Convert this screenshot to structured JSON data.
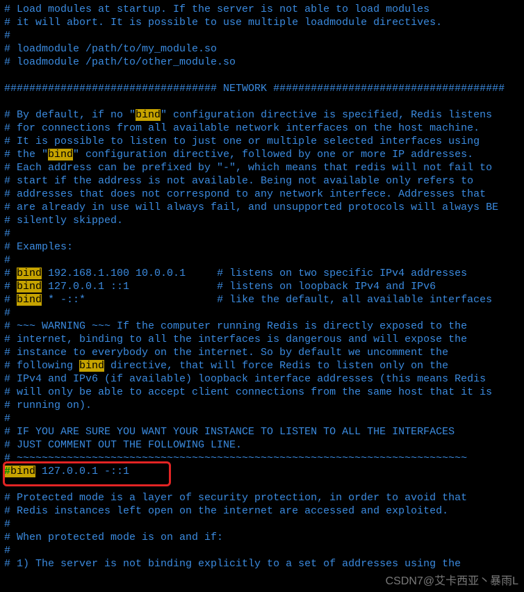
{
  "lines": [
    {
      "segments": [
        {
          "t": "# Load modules at startup. If the server is not able to load modules"
        }
      ]
    },
    {
      "segments": [
        {
          "t": "# it will abort. It is possible to use multiple loadmodule directives."
        }
      ]
    },
    {
      "segments": [
        {
          "t": "#"
        }
      ]
    },
    {
      "segments": [
        {
          "t": "# loadmodule /path/to/my_module.so"
        }
      ]
    },
    {
      "segments": [
        {
          "t": "# loadmodule /path/to/other_module.so"
        }
      ]
    },
    {
      "segments": [
        {
          "t": ""
        }
      ]
    },
    {
      "segments": [
        {
          "t": "################################## NETWORK #####################################"
        }
      ]
    },
    {
      "segments": [
        {
          "t": ""
        }
      ]
    },
    {
      "segments": [
        {
          "t": "# By default, if no \""
        },
        {
          "t": "bind",
          "cls": "hl"
        },
        {
          "t": "\" configuration directive is specified, Redis listens"
        }
      ]
    },
    {
      "segments": [
        {
          "t": "# for connections from all available network interfaces on the host machine."
        }
      ]
    },
    {
      "segments": [
        {
          "t": "# It is possible to listen to just one or multiple selected interfaces using"
        }
      ]
    },
    {
      "segments": [
        {
          "t": "# the \""
        },
        {
          "t": "bind",
          "cls": "hl"
        },
        {
          "t": "\" configuration directive, followed by one or more IP addresses."
        }
      ]
    },
    {
      "segments": [
        {
          "t": "# Each address can be prefixed by \"-\", which means that redis will not fail to"
        }
      ]
    },
    {
      "segments": [
        {
          "t": "# start if the address is not available. Being not available only refers to"
        }
      ]
    },
    {
      "segments": [
        {
          "t": "# addresses that does not correspond to any network interfece. Addresses that"
        }
      ]
    },
    {
      "segments": [
        {
          "t": "# are already in use will always fail, and unsupported protocols will always BE"
        }
      ]
    },
    {
      "segments": [
        {
          "t": "# silently skipped."
        }
      ]
    },
    {
      "segments": [
        {
          "t": "#"
        }
      ]
    },
    {
      "segments": [
        {
          "t": "# Examples:"
        }
      ]
    },
    {
      "segments": [
        {
          "t": "#"
        }
      ]
    },
    {
      "segments": [
        {
          "t": "# "
        },
        {
          "t": "bind",
          "cls": "hl"
        },
        {
          "t": " 192.168.1.100 10.0.0.1     # listens on two specific IPv4 addresses"
        }
      ]
    },
    {
      "segments": [
        {
          "t": "# "
        },
        {
          "t": "bind",
          "cls": "hl"
        },
        {
          "t": " 127.0.0.1 ::1              # listens on loopback IPv4 and IPv6"
        }
      ]
    },
    {
      "segments": [
        {
          "t": "# "
        },
        {
          "t": "bind",
          "cls": "hl"
        },
        {
          "t": " * -::*                     # like the default, all available interfaces"
        }
      ]
    },
    {
      "segments": [
        {
          "t": "#"
        }
      ]
    },
    {
      "segments": [
        {
          "t": "# ~~~ WARNING ~~~ If the computer running Redis is directly exposed to the"
        }
      ]
    },
    {
      "segments": [
        {
          "t": "# internet, binding to all the interfaces is dangerous and will expose the"
        }
      ]
    },
    {
      "segments": [
        {
          "t": "# instance to everybody on the internet. So by default we uncomment the"
        }
      ]
    },
    {
      "segments": [
        {
          "t": "# following "
        },
        {
          "t": "bind",
          "cls": "hl"
        },
        {
          "t": " directive, that will force Redis to listen only on the"
        }
      ]
    },
    {
      "segments": [
        {
          "t": "# IPv4 and IPv6 (if available) loopback interface addresses (this means Redis"
        }
      ]
    },
    {
      "segments": [
        {
          "t": "# will only be able to accept client connections from the same host that it is"
        }
      ]
    },
    {
      "segments": [
        {
          "t": "# running on)."
        }
      ]
    },
    {
      "segments": [
        {
          "t": "#"
        }
      ]
    },
    {
      "segments": [
        {
          "t": "# IF YOU ARE SURE YOU WANT YOUR INSTANCE TO LISTEN TO ALL THE INTERFACES"
        }
      ]
    },
    {
      "segments": [
        {
          "t": "# JUST COMMENT OUT THE FOLLOWING LINE."
        }
      ]
    },
    {
      "segments": [
        {
          "t": "# ~~~~~~~~~~~~~~~~~~~~~~~~~~~~~~~~~~~~~~~~~~~~~~~~~~~~~~~~~~~~~~~~~~~~~~~~"
        }
      ]
    },
    {
      "segments": [
        {
          "t": "#",
          "cls": "hlgreen"
        },
        {
          "t": "bind",
          "cls": "hl"
        },
        {
          "t": " 127.0.0.1 -::1"
        }
      ]
    },
    {
      "segments": [
        {
          "t": ""
        }
      ]
    },
    {
      "segments": [
        {
          "t": "# Protected mode is a layer of security protection, in order to avoid that"
        }
      ]
    },
    {
      "segments": [
        {
          "t": "# Redis instances left open on the internet are accessed and exploited."
        }
      ]
    },
    {
      "segments": [
        {
          "t": "#"
        }
      ]
    },
    {
      "segments": [
        {
          "t": "# When protected mode is on and if:"
        }
      ]
    },
    {
      "segments": [
        {
          "t": "#"
        }
      ]
    },
    {
      "segments": [
        {
          "t": "# 1) The server is not binding explicitly to a set of addresses using the"
        }
      ]
    }
  ],
  "watermark": "CSDN7@艾卡西亚丶暴雨L"
}
